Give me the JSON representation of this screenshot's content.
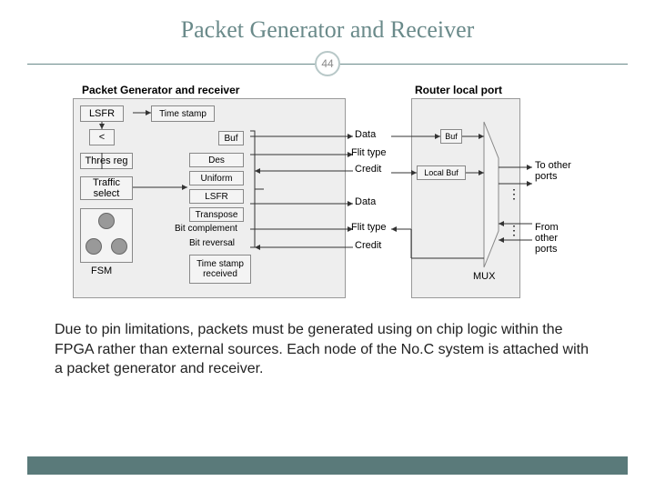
{
  "title": "Packet Generator and Receiver",
  "page_number": "44",
  "diagram": {
    "panel_left_title": "Packet Generator and receiver",
    "panel_right_title": "Router local port",
    "lsfr": "LSFR",
    "lt": "<",
    "thres": "Thres reg",
    "traffic": "Traffic select",
    "fsm": "FSM",
    "timestamp": "Time stamp",
    "buf1": "Buf",
    "des": "Des",
    "uniform": "Uniform",
    "lsfr2": "LSFR",
    "transpose": "Transpose",
    "bitcomp": "Bit complement",
    "bitrev": "Bit reversal",
    "ts_recv": "Time stamp received",
    "data1": "Data",
    "flit1": "Flit type",
    "credit1": "Credit",
    "data2": "Data",
    "flit2": "Flit type",
    "credit2": "Credit",
    "buf2": "Buf",
    "localbuf": "Local Buf",
    "mux": "MUX",
    "to_other": "To other ports",
    "from_other": "From other ports"
  },
  "caption": "Due to pin limitations, packets must be generated using on chip logic within the FPGA rather than external sources. Each node of the No.C system is attached with a packet generator and receiver."
}
